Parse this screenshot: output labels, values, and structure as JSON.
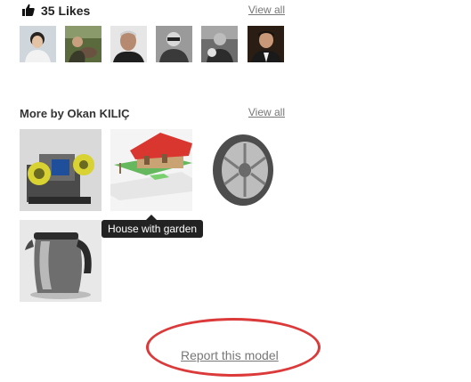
{
  "likes": {
    "icon": "thumbs-up-icon",
    "count_label": "35 Likes",
    "view_all_label": "View all",
    "avatars": [
      {
        "name": "user-avatar-1"
      },
      {
        "name": "user-avatar-2"
      },
      {
        "name": "user-avatar-3"
      },
      {
        "name": "user-avatar-4"
      },
      {
        "name": "user-avatar-5"
      },
      {
        "name": "user-avatar-6"
      }
    ]
  },
  "more_by": {
    "title": "More by Okan KILIÇ",
    "view_all_label": "View all",
    "tooltip": "House with garden"
  },
  "report": {
    "label": "Report this model",
    "highlight_color": "#dc3a3a"
  }
}
